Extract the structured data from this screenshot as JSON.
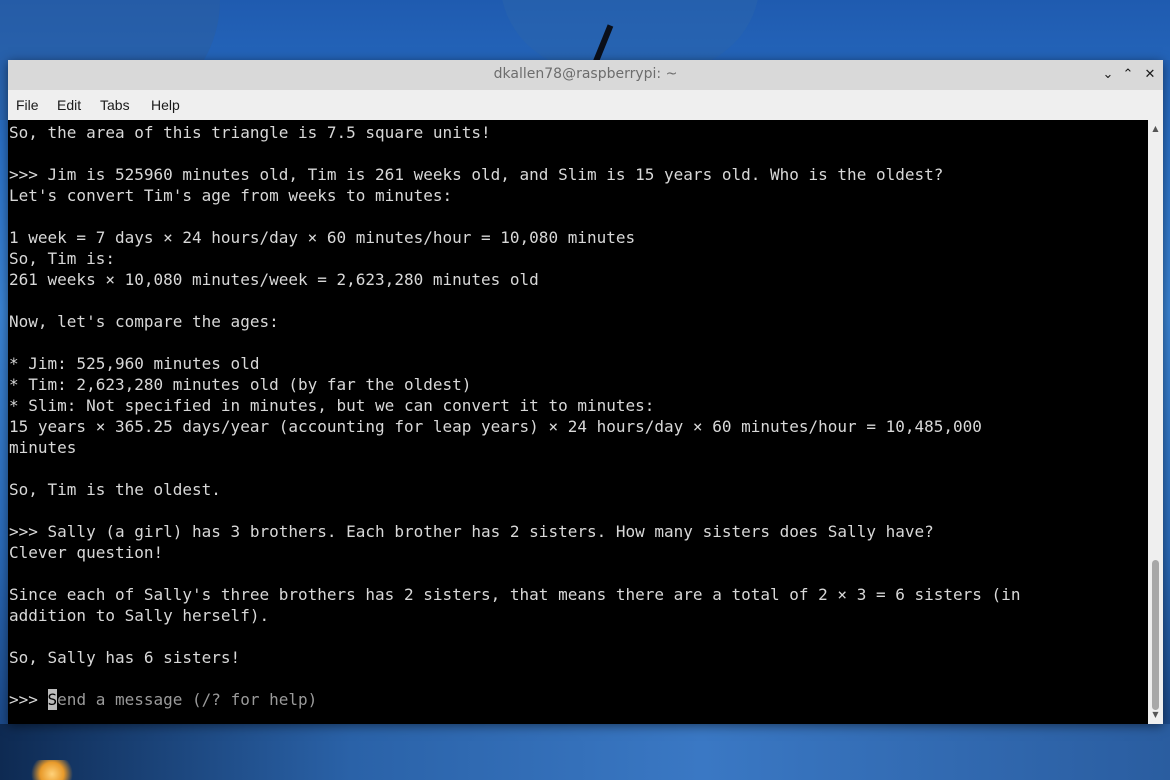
{
  "window": {
    "title": "dkallen78@raspberrypi: ~"
  },
  "menu": {
    "file": "File",
    "edit": "Edit",
    "tabs": "Tabs",
    "help": "Help"
  },
  "icons": {
    "minimize": "chevron-down-icon",
    "maximize": "chevron-up-icon",
    "close": "close-icon"
  },
  "terminal": {
    "lines": [
      "So, the area of this triangle is 7.5 square units!",
      "",
      ">>> Jim is 525960 minutes old, Tim is 261 weeks old, and Slim is 15 years old. Who is the oldest?",
      "Let's convert Tim's age from weeks to minutes:",
      "",
      "1 week = 7 days × 24 hours/day × 60 minutes/hour = 10,080 minutes",
      "So, Tim is:",
      "261 weeks × 10,080 minutes/week = 2,623,280 minutes old",
      "",
      "Now, let's compare the ages:",
      "",
      "* Jim: 525,960 minutes old",
      "* Tim: 2,623,280 minutes old (by far the oldest)",
      "* Slim: Not specified in minutes, but we can convert it to minutes:",
      "15 years × 365.25 days/year (accounting for leap years) × 24 hours/day × 60 minutes/hour = 10,485,000",
      "minutes",
      "",
      "So, Tim is the oldest.",
      "",
      ">>> Sally (a girl) has 3 brothers. Each brother has 2 sisters. How many sisters does Sally have?",
      "Clever question!",
      "",
      "Since each of Sally's three brothers has 2 sisters, that means there are a total of 2 × 3 = 6 sisters (in",
      "addition to Sally herself).",
      "",
      "So, Sally has 6 sisters!",
      ""
    ],
    "prompt": ">>> ",
    "placeholder_first": "S",
    "placeholder_rest": "end a message (/? for help)"
  },
  "colors": {
    "terminal_bg": "#000000",
    "terminal_fg": "#d8d8d8",
    "titlebar_bg": "#d9d9d9"
  }
}
